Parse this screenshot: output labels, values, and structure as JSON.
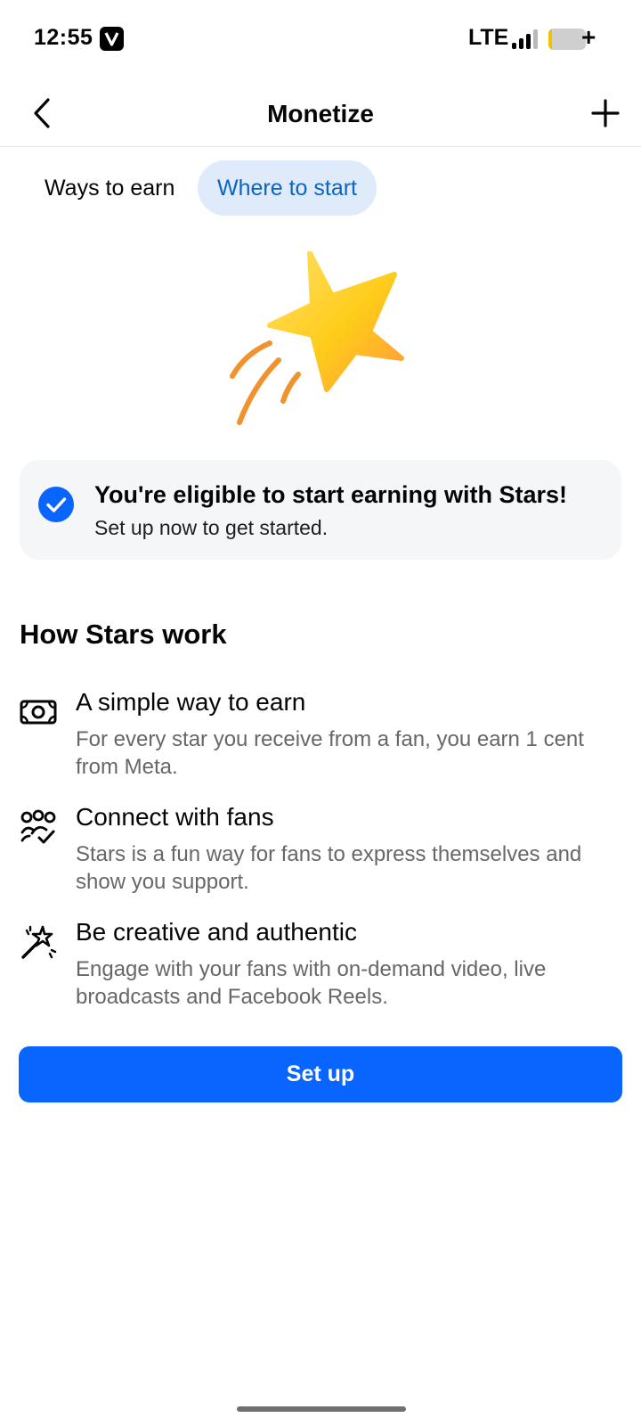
{
  "status_bar": {
    "time": "12:55",
    "network": "LTE",
    "app_icon": "v-badge-icon"
  },
  "header": {
    "title": "Monetize",
    "back_icon": "chevron-left-icon",
    "add_icon": "plus-icon"
  },
  "tabs": [
    {
      "label": "Ways to earn",
      "selected": false
    },
    {
      "label": "Where to start",
      "selected": true
    }
  ],
  "hero_icon": "shooting-star-icon",
  "eligibility": {
    "icon": "check-circle-icon",
    "title": "You're eligible to start earning with Stars!",
    "subtitle": "Set up now to get started."
  },
  "how_it_works": {
    "title": "How Stars work",
    "items": [
      {
        "icon": "money-icon",
        "title": "A simple way to earn",
        "description": "For every star you receive from a fan, you earn 1 cent from Meta."
      },
      {
        "icon": "people-check-icon",
        "title": "Connect with fans",
        "description": "Stars is a fun way for fans to express themselves and show you support."
      },
      {
        "icon": "magic-wand-icon",
        "title": "Be creative and authentic",
        "description": "Engage with your fans with on-demand video, live broadcasts and Facebook Reels."
      }
    ]
  },
  "cta": {
    "label": "Set up"
  },
  "colors": {
    "primary_button": "#0866ff",
    "selected_tab_bg": "#dfeafb",
    "selected_tab_text": "#0a66c2",
    "card_bg": "#f5f6f8",
    "secondary_text": "#65676b"
  }
}
